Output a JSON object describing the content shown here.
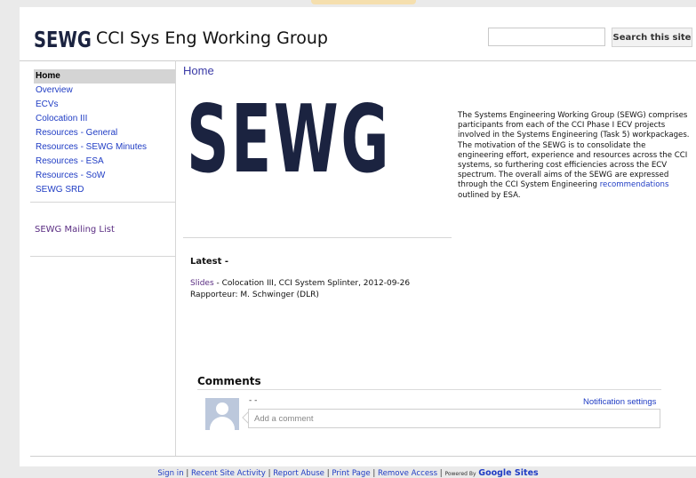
{
  "header": {
    "logo_text": "SEWG",
    "site_title": "CCI Sys Eng Working Group",
    "search_button": "Search this site",
    "search_value": ""
  },
  "sidebar": {
    "items": [
      {
        "label": "Home"
      },
      {
        "label": "Overview"
      },
      {
        "label": "ECVs"
      },
      {
        "label": "Colocation III"
      },
      {
        "label": "Resources - General"
      },
      {
        "label": "Resources - SEWG Minutes"
      },
      {
        "label": "Resources - ESA"
      },
      {
        "label": "Resources - SoW"
      },
      {
        "label": "SEWG SRD"
      }
    ],
    "mailing_list": "SEWG Mailing List"
  },
  "main": {
    "page_title": "Home",
    "big_logo": "SEWG",
    "intro_text": "The Systems Engineering Working Group (SEWG) comprises participants from each of the CCI Phase I ECV projects involved in the Systems Engineering (Task 5) workpackages. The motivation of the SEWG is to consolidate the engineering effort, experience and resources across the CCI systems, so furthering cost efficiencies across the ECV spectrum. The overall aims of the SEWG are expressed through the CCI System Engineering",
    "intro_link": "recommendations",
    "intro_tail": "outlined by ESA.",
    "latest_label": "Latest -",
    "latest_link": "Slides",
    "latest_text": "- Colocation III, CCI System Splinter, 2012-09-26",
    "latest_line2": "Rapporteur: M. Schwinger (DLR)"
  },
  "comments": {
    "title": "Comments",
    "author": "- -",
    "notification_settings": "Notification settings",
    "placeholder": "Add a comment"
  },
  "footer": {
    "sign_in": "Sign in",
    "recent_activity": "Recent Site Activity",
    "report_abuse": "Report Abuse",
    "print_page": "Print Page",
    "remove_access": "Remove Access",
    "powered_by": "Powered By",
    "google_sites": "Google Sites",
    "separator": "|"
  },
  "colors": {
    "link": "#1f3cc4",
    "visited": "#5a2d82",
    "logo": "#1b2340",
    "nav_selected_bg": "#d4d4d4"
  }
}
